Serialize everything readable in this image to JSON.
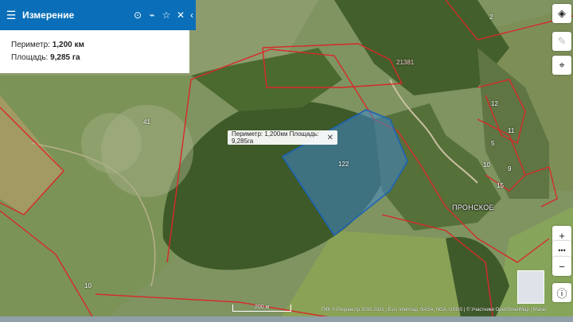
{
  "panel": {
    "title": "Измерение",
    "perimeter_label": "Периметр:",
    "perimeter_value": "1,200 км",
    "area_label": "Площадь:",
    "area_value": "9,285 га"
  },
  "tooltip": {
    "text": "Периметр: 1,200км Площадь: 9,285га"
  },
  "parcel_labels": [
    "41",
    "122",
    "21381",
    "10",
    "11",
    "12",
    "10",
    "9",
    "5",
    "2",
    "15"
  ],
  "village": "ПРОНСКОЕ",
  "scale": {
    "label": "200 м"
  },
  "attribution": "ПКК © Росреестр 2010-2021 | Esri, Intermap, NASA, NGA, USGS | © Участники OpenStreetMap | Maxar",
  "colors": {
    "header": "#0a6fb8",
    "boundary": "#d62a2a",
    "measure_fill": "#3f86c8",
    "measure_stroke": "#1e63b5"
  },
  "icons": [
    "menu-icon",
    "locate-icon",
    "ruler-icon",
    "star-icon",
    "close-icon",
    "collapse-icon",
    "layers-icon",
    "pencil-icon",
    "crosshair-icon",
    "zoom-in-icon",
    "more-icon",
    "zoom-out-icon",
    "info-icon"
  ]
}
